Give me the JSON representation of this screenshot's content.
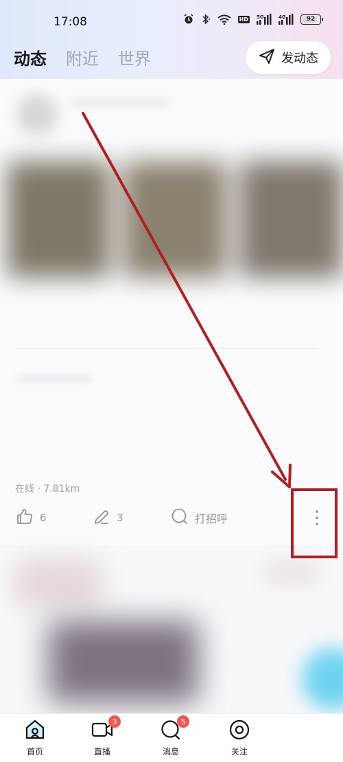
{
  "status_bar": {
    "time": "17:08",
    "battery": "92",
    "battery_fraction": 0.92,
    "icons": [
      "alarm-icon",
      "bluetooth-icon",
      "wifi-icon",
      "hd-icon",
      "signal-5g-icon",
      "signal-4g-icon",
      "battery-icon"
    ],
    "hd_label": "HD"
  },
  "header": {
    "tabs": [
      {
        "label": "动态",
        "active": true
      },
      {
        "label": "附近",
        "active": false
      },
      {
        "label": "世界",
        "active": false
      }
    ],
    "post_button_label": "发动态"
  },
  "feed": {
    "post": {
      "meta": "在线 · 7.81km",
      "likes": "6",
      "comments": "3",
      "greet_label": "打招呼"
    }
  },
  "bottom_nav": {
    "items": [
      {
        "label": "首页",
        "icon": "home-icon",
        "active": true
      },
      {
        "label": "直播",
        "icon": "video-icon",
        "badge": "3"
      },
      {
        "label": "消息",
        "icon": "message-icon",
        "badge": "5"
      },
      {
        "label": "关注",
        "icon": "eye-icon"
      }
    ]
  },
  "colors": {
    "annotation": "#b11f1f",
    "badge": "#f4554f",
    "home_accent": "#47c3e6"
  }
}
